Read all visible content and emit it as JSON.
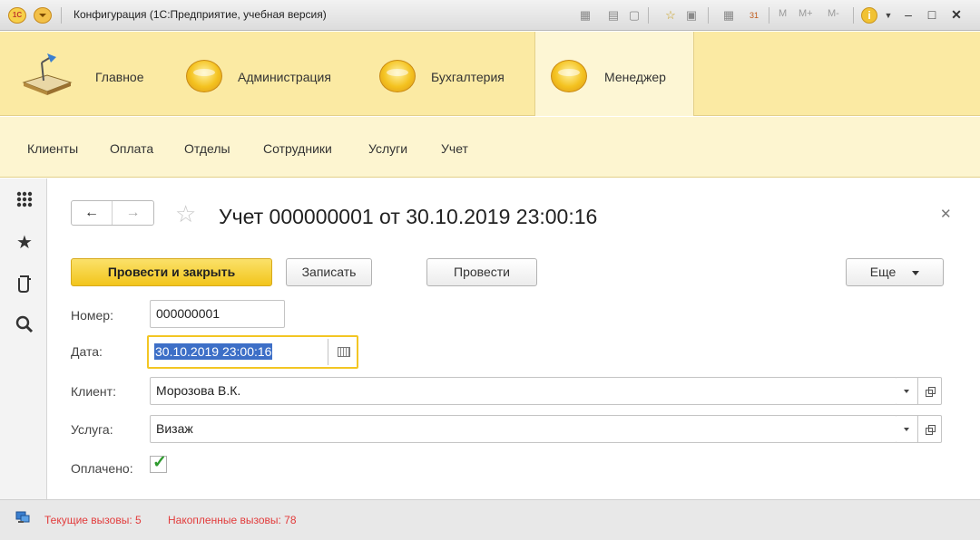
{
  "window": {
    "logo_text": "1С",
    "title": "Конфигурация  (1С:Предприятие, учебная версия)",
    "toolbar": {
      "m": "M",
      "m_plus": "M+",
      "m_minus": "M-",
      "info": "i",
      "calendar_day": "31"
    }
  },
  "sections": [
    {
      "label": "Главное",
      "icon": "desk-lamp-icon",
      "active": false
    },
    {
      "label": "Администрация",
      "icon": "coin-icon",
      "active": false
    },
    {
      "label": "Бухгалтерия",
      "icon": "coin-icon",
      "active": false
    },
    {
      "label": "Менеджер",
      "icon": "coin-icon",
      "active": true
    }
  ],
  "subnav": [
    "Клиенты",
    "Оплата",
    "Отделы",
    "Сотрудники",
    "Услуги",
    "Учет"
  ],
  "leftpanel": [
    "apps-grid-icon",
    "favorites-star-icon",
    "history-icon",
    "search-icon"
  ],
  "form": {
    "title": "Учет 000000001 от 30.10.2019 23:00:16",
    "buttons": {
      "post_close": "Провести и закрыть",
      "save": "Записать",
      "post": "Провести",
      "more": "Еще"
    },
    "fields": {
      "number": {
        "label": "Номер:",
        "value": "000000001"
      },
      "date": {
        "label": "Дата:",
        "value": "30.10.2019 23:00:16"
      },
      "client": {
        "label": "Клиент:",
        "value": "Морозова В.К."
      },
      "service": {
        "label": "Услуга:",
        "value": "Визаж"
      },
      "paid": {
        "label": "Оплачено:",
        "checked": true
      }
    }
  },
  "status": {
    "current_calls": "Текущие вызовы: 5",
    "accumulated_calls": "Накопленные вызовы: 78"
  },
  "colors": {
    "section_bar": "#fbeaa3",
    "primary_button": "#f2c51b",
    "status_text": "#e23b3b",
    "selection": "#3d6fc7"
  }
}
